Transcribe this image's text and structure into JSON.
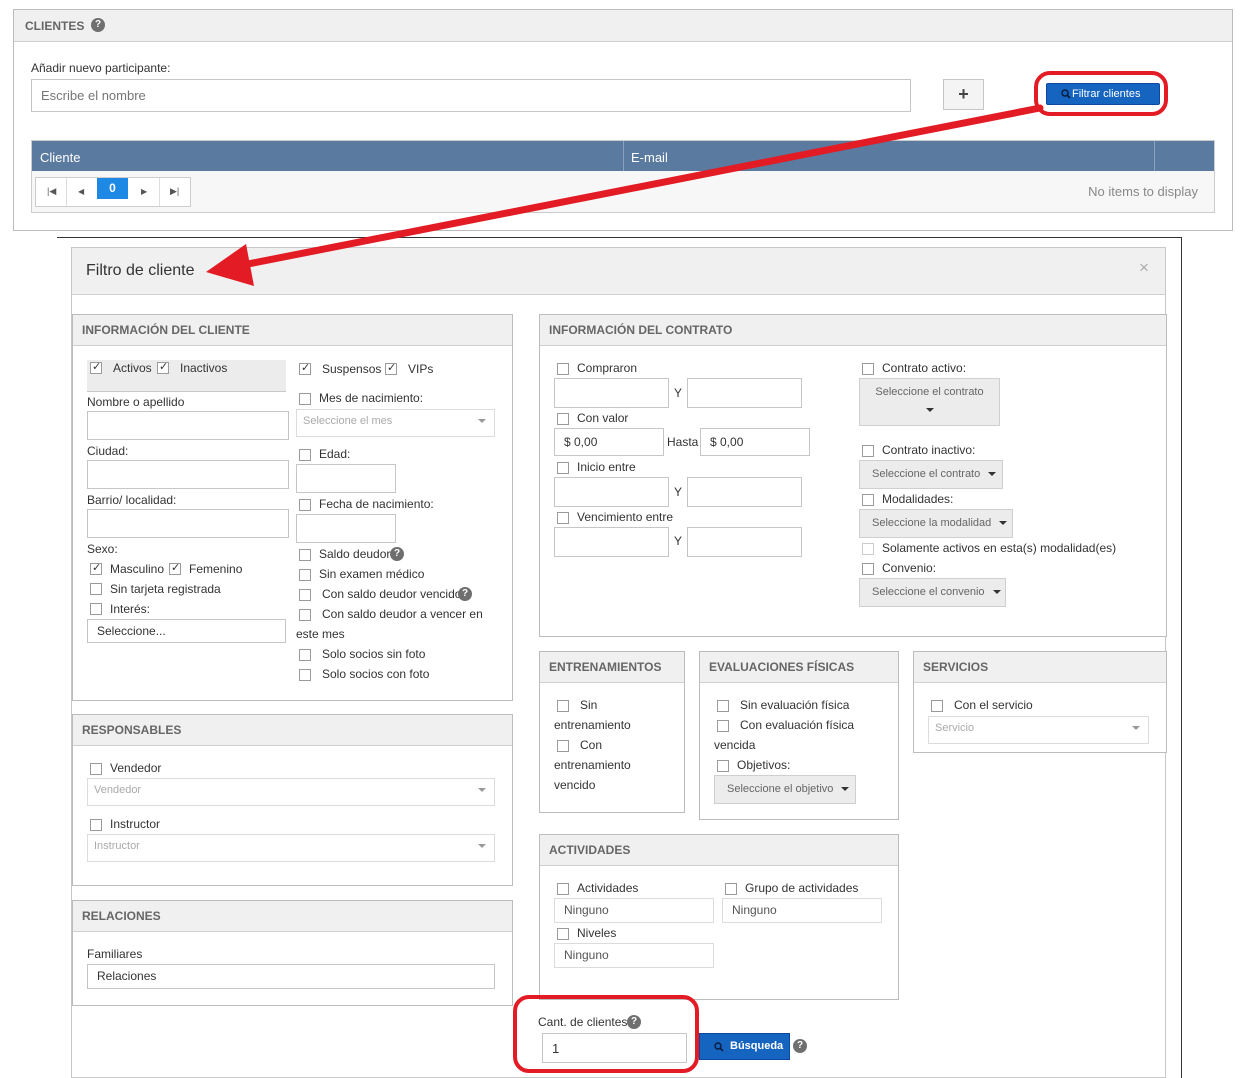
{
  "clients_panel": {
    "title": "CLIENTES",
    "add_label": "Añadir nuevo participante:",
    "name_placeholder": "Escribe el nombre",
    "add_button": "+",
    "filter_button": "Filtrar clientes",
    "table": {
      "columns": [
        "Cliente",
        "E-mail"
      ],
      "page": "0",
      "empty_text": "No items to display"
    }
  },
  "modal": {
    "title": "Filtro de cliente",
    "close": "×",
    "client_info": {
      "title": "INFORMACIÓN DEL CLIENTE",
      "activos": "Activos",
      "inactivos": "Inactivos",
      "suspensos": "Suspensos",
      "vips": "VIPs",
      "nombre": "Nombre o apellido",
      "ciudad": "Ciudad:",
      "barrio": "Barrio/ localidad:",
      "sexo": "Sexo:",
      "masculino": "Masculino",
      "femenino": "Femenino",
      "sin_tarjeta": "Sin tarjeta registrada",
      "interes": "Interés:",
      "interes_select": "Seleccione...",
      "mes_nacimiento": "Mes de nacimiento:",
      "mes_placeholder": "Seleccione el mes",
      "edad": "Edad:",
      "fecha_nacimiento": "Fecha de nacimiento:",
      "saldo_deudor": "Saldo deudor",
      "sin_examen": "Sin examen médico",
      "saldo_vencido": "Con saldo deudor vencido",
      "saldo_vencer_1": "Con saldo deudor a vencer en",
      "saldo_vencer_2": "este mes",
      "sin_foto": "Solo socios sin foto",
      "con_foto": "Solo socios con foto"
    },
    "contract_info": {
      "title": "INFORMACIÓN DEL CONTRATO",
      "compraron": "Compraron",
      "y": "Y",
      "con_valor": "Con valor",
      "valor_desde": "$ 0,00",
      "hasta": "Hasta",
      "valor_hasta": "$ 0,00",
      "inicio_entre": "Inicio entre",
      "vencimiento_entre": "Vencimiento entre",
      "contrato_activo": "Contrato activo:",
      "seleccione_contrato": "Seleccione el contrato",
      "contrato_inactivo": "Contrato inactivo:",
      "modalidades": "Modalidades:",
      "seleccione_modalidad": "Seleccione la modalidad",
      "solamente_activos": "Solamente activos en esta(s) modalidad(es)",
      "convenio": "Convenio:",
      "seleccione_convenio": "Seleccione el convenio"
    },
    "trainings": {
      "title": "ENTRENAMIENTOS",
      "sin_1": "Sin",
      "sin_2": "entrenamiento",
      "con_1": "Con",
      "con_2": "entrenamiento",
      "con_3": "vencido"
    },
    "evaluations": {
      "title": "EVALUACIONES FÍSICAS",
      "sin": "Sin evaluación física",
      "con_1": "Con evaluación física",
      "con_2": "vencida",
      "objetivos": "Objetivos:",
      "seleccione_objetivo": "Seleccione el objetivo"
    },
    "services": {
      "title": "SERVICIOS",
      "con_servicio": "Con el servicio",
      "servicio_placeholder": "Servicio"
    },
    "responsables": {
      "title": "RESPONSABLES",
      "vendedor": "Vendedor",
      "vendedor_placeholder": "Vendedor",
      "instructor": "Instructor",
      "instructor_placeholder": "Instructor"
    },
    "activities": {
      "title": "ACTIVIDADES",
      "actividades": "Actividades",
      "actividades_value": "Ninguno",
      "grupo": "Grupo de actividades",
      "grupo_value": "Ninguno",
      "niveles": "Niveles",
      "niveles_value": "Ninguno"
    },
    "relaciones": {
      "title": "RELACIONES",
      "familiares": "Familiares",
      "relaciones_value": "Relaciones"
    },
    "footer": {
      "cant_label": "Cant. de clientes",
      "cant_value": "1",
      "search_button": "Búsqueda"
    }
  },
  "help_glyph": "?",
  "colors": {
    "accent_blue": "#1565c0",
    "table_header": "#5a7aa0",
    "annotation_red": "#e21b24"
  }
}
